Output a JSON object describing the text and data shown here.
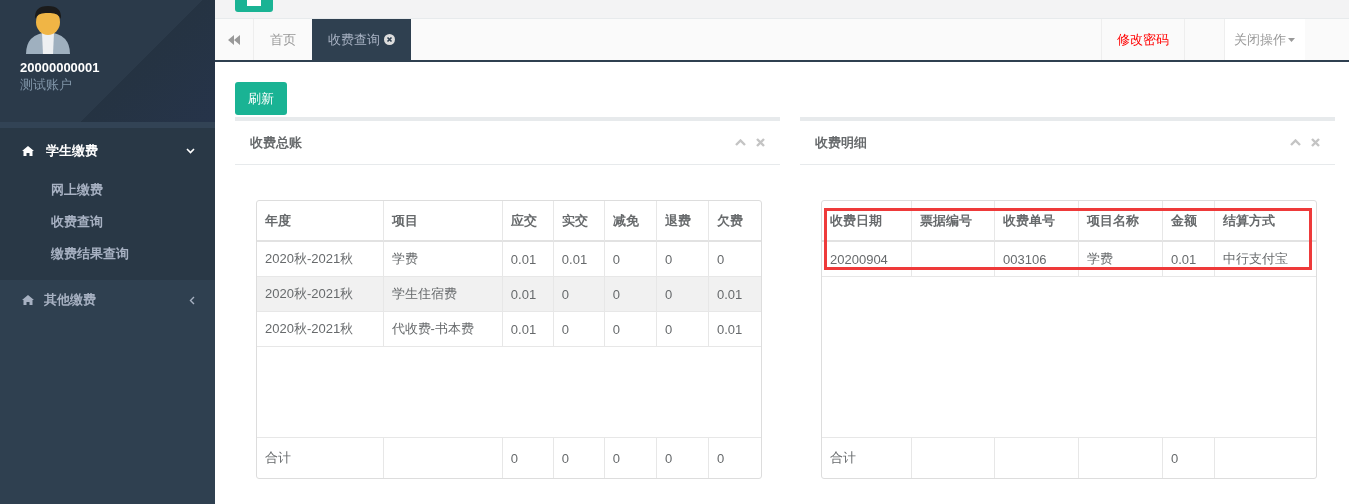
{
  "sidebar": {
    "user": {
      "id": "20000000001",
      "name": "测试账户"
    },
    "menu": [
      {
        "label": "学生缴费",
        "expanded": true,
        "children": [
          {
            "label": "网上缴费"
          },
          {
            "label": "收费查询"
          },
          {
            "label": "缴费结果查询"
          }
        ]
      },
      {
        "label": "其他缴费",
        "expanded": false
      }
    ]
  },
  "tabs": [
    {
      "label": "首页",
      "selected": false,
      "closable": false
    },
    {
      "label": "收费查询",
      "selected": true,
      "closable": true
    }
  ],
  "toolbar": {
    "change_password": "修改密码",
    "close_menu": "关闭操作"
  },
  "refresh_button": "刷新",
  "panels": [
    {
      "title": "收费总账",
      "highlighted": false,
      "table": {
        "columns": [
          "年度",
          "项目",
          "应交",
          "实交",
          "减免",
          "退费",
          "欠费"
        ],
        "rows": [
          {
            "shaded": false,
            "cells": [
              "2020秋-2021秋",
              "学费",
              "0.01",
              "0.01",
              "0",
              "0",
              "0"
            ]
          },
          {
            "shaded": true,
            "cells": [
              "2020秋-2021秋",
              "学生住宿费",
              "0.01",
              "0",
              "0",
              "0",
              "0.01"
            ]
          },
          {
            "shaded": false,
            "cells": [
              "2020秋-2021秋",
              "代收费-书本费",
              "0.01",
              "0",
              "0",
              "0",
              "0.01"
            ]
          }
        ],
        "total": {
          "0": "合计",
          "2": "0",
          "3": "0",
          "4": "0",
          "5": "0",
          "6": "0"
        }
      }
    },
    {
      "title": "收费明细",
      "highlighted": true,
      "table": {
        "columns": [
          "收费日期",
          "票据编号",
          "收费单号",
          "项目名称",
          "金额",
          "结算方式"
        ],
        "rows": [
          {
            "shaded": false,
            "cells": {
              "0": "20200904",
              "2": "003106",
              "3": "学费",
              "4": "0.01",
              "5": "中行支付宝"
            }
          }
        ],
        "total": {
          "0": "合计",
          "4": "0"
        }
      }
    }
  ]
}
